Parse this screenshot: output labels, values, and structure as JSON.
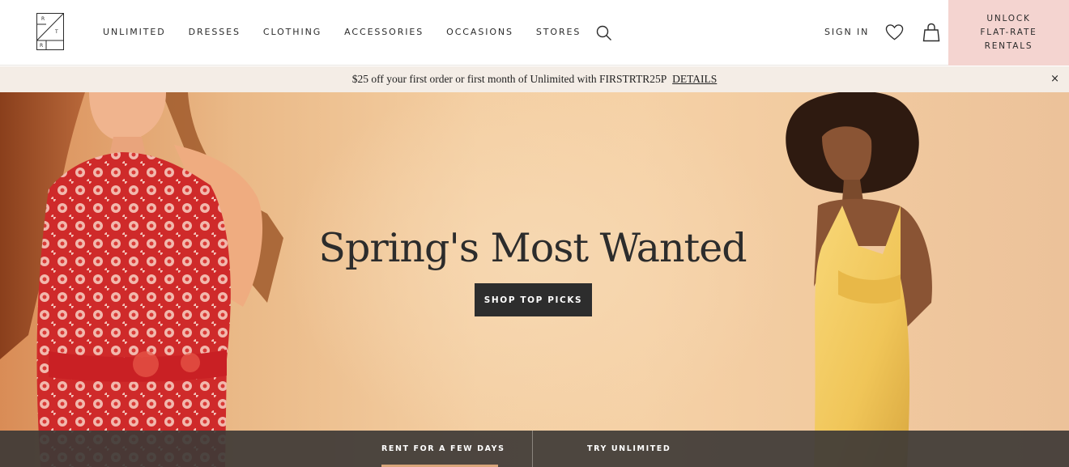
{
  "header": {
    "logo_letters": [
      "R",
      "T",
      "R"
    ],
    "nav_items": [
      "UNLIMITED",
      "DRESSES",
      "CLOTHING",
      "ACCESSORIES",
      "OCCASIONS",
      "STORES"
    ],
    "search_icon": "search-icon",
    "sign_in_label": "SIGN IN",
    "heart_icon": "heart-icon",
    "bag_icon": "shopping-bag-icon",
    "unlock_lines": [
      "UNLOCK",
      "FLAT-RATE",
      "RENTALS"
    ],
    "unlock_bg_color": "#f4d4d0"
  },
  "promo": {
    "text": "$25 off your first order or first month of Unlimited with FIRSTRTR25P",
    "details_label": "DETAILS",
    "close_label": "×",
    "bg_color": "#f4ede6"
  },
  "hero": {
    "title": "Spring's Most Wanted",
    "cta_label": "SHOP TOP PICKS",
    "cta_color": "#2d2d2d"
  },
  "tabs": {
    "items": [
      "RENT FOR A FEW DAYS",
      "TRY UNLIMITED"
    ],
    "active_index": 0,
    "accent_color": "#d9a57a"
  }
}
